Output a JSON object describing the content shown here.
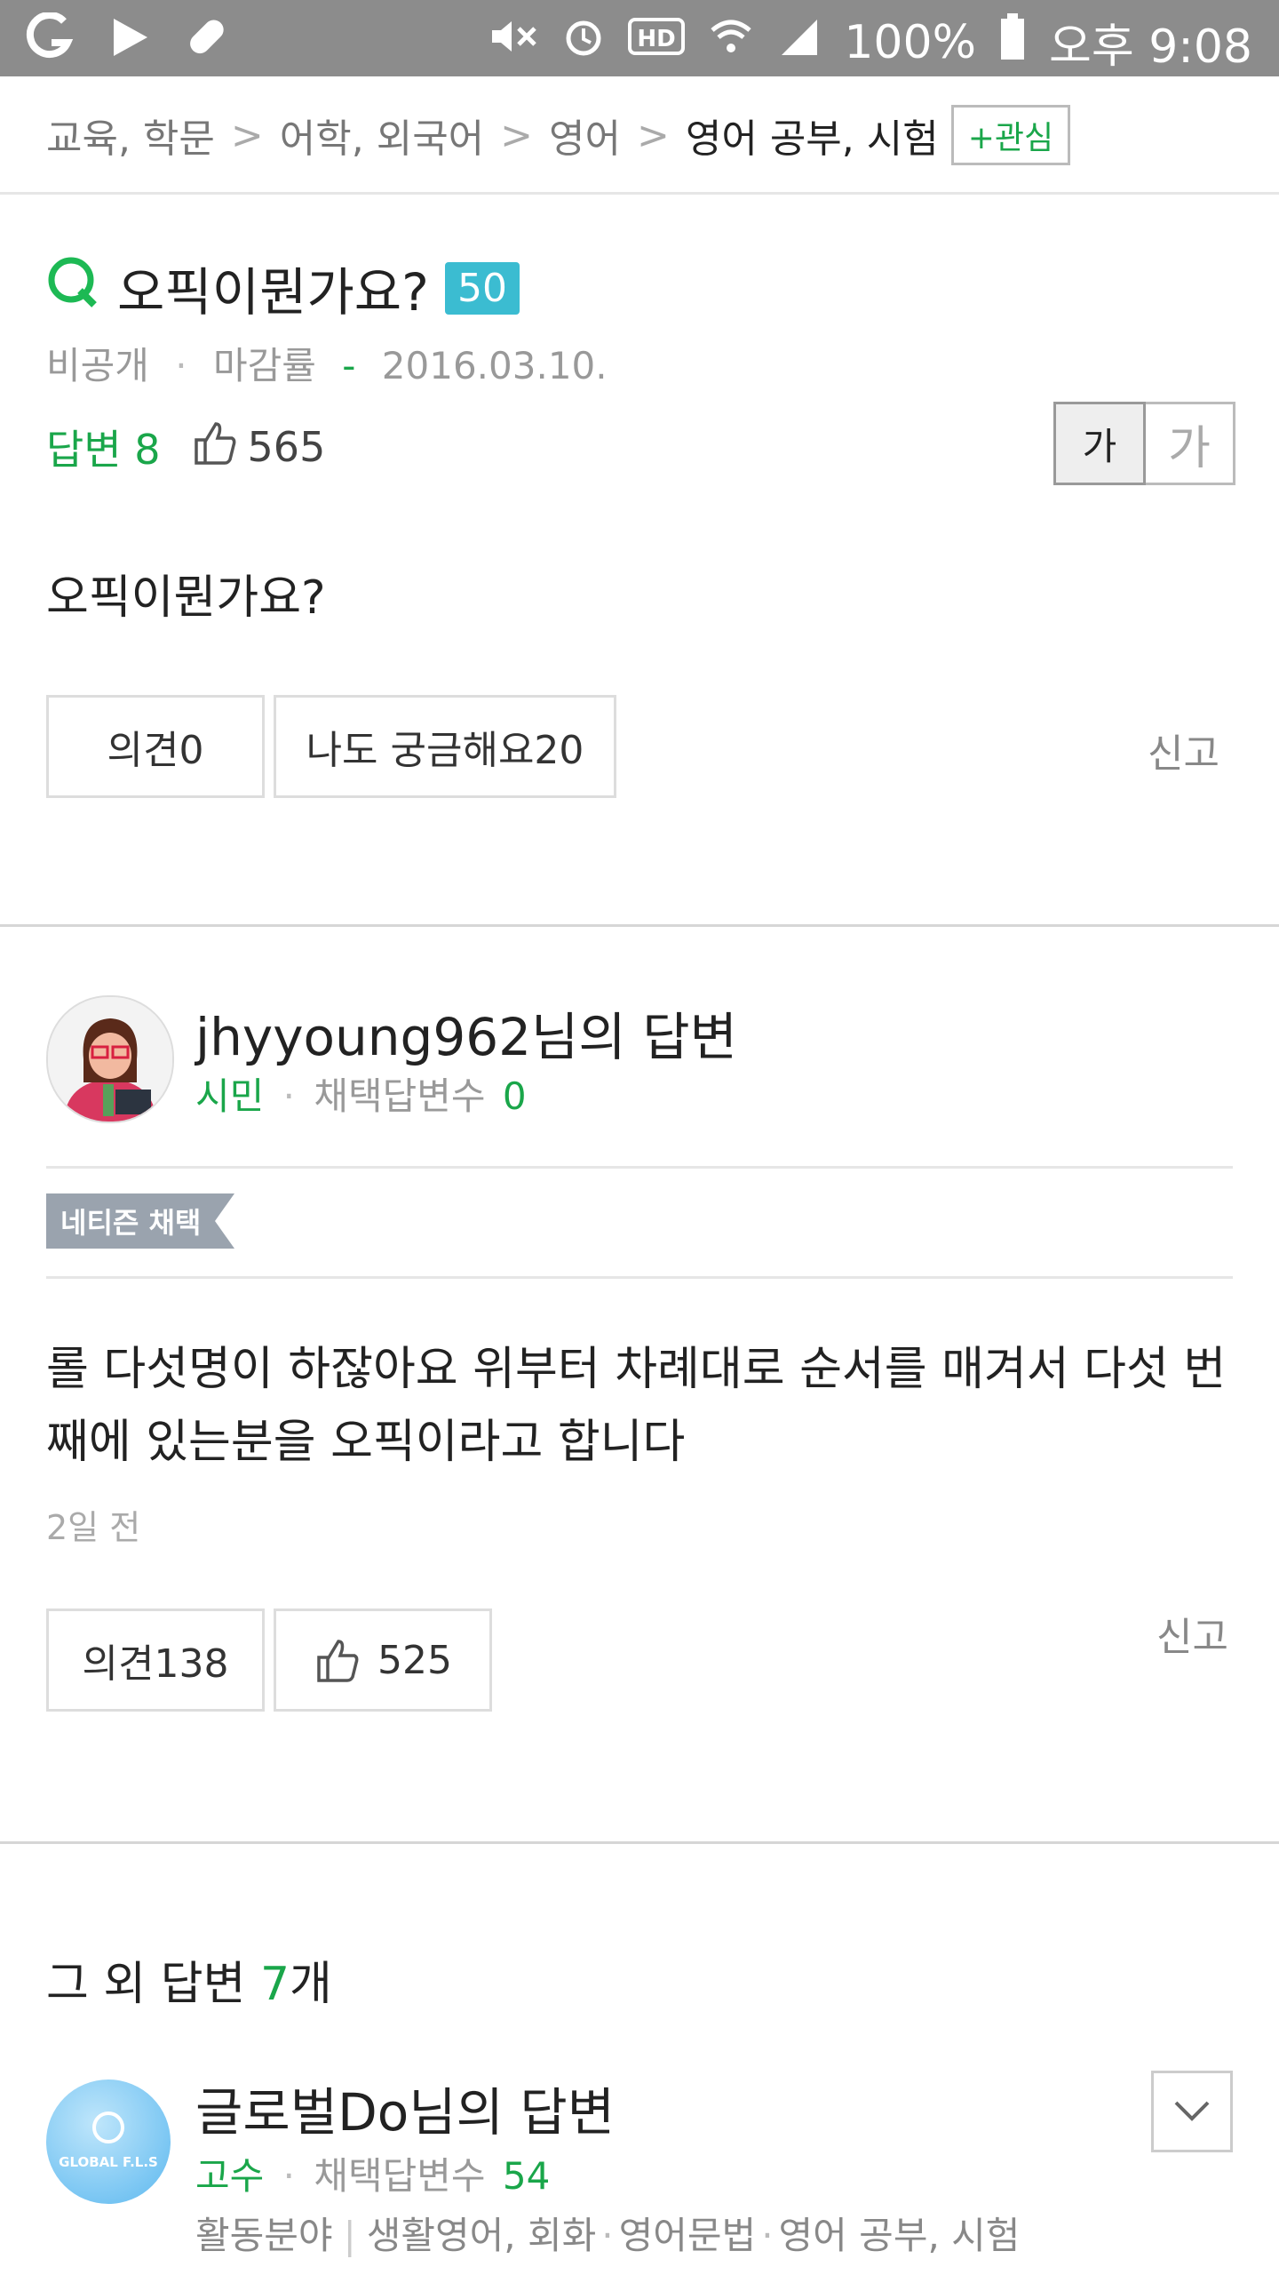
{
  "status_bar": {
    "battery": "100%",
    "time": "오후 9:08",
    "network": "HD"
  },
  "breadcrumb": {
    "items": [
      "교육, 학문",
      "어학, 외국어",
      "영어",
      "영어 공부, 시험"
    ],
    "separator": ">",
    "follow_label": "+관심"
  },
  "question": {
    "title": "오픽이뭔가요?",
    "points": "50",
    "visibility": "비공개",
    "deadline_label": "마감률",
    "deadline_value": "-",
    "date": "2016.03.10.",
    "answers_label": "답변 8",
    "likes": "565",
    "font_small": "가",
    "font_large": "가",
    "body": "오픽이뭔가요?",
    "opinion_button": "의견0",
    "curious_button": "나도 궁금해요20",
    "report": "신고"
  },
  "answer1": {
    "author": "jhyyoung962님의 답변",
    "rank": "시민",
    "adopted_label": "채택답변수",
    "adopted_count": "0",
    "badge": "네티즌 채택",
    "body": "롤 다섯명이 하잖아요 위부터 차례대로 순서를 매겨서 다섯 번째에 있는분을 오픽이라고 합니다",
    "time": "2일 전",
    "opinion_button": "의견138",
    "likes": "525",
    "report": "신고"
  },
  "others": {
    "title_prefix": "그 외 답변 ",
    "count": "7",
    "title_suffix": "개"
  },
  "answer2": {
    "author": "글로벌Do님의 답변",
    "rank": "고수",
    "adopted_label": "채택답변수",
    "adopted_count": "54",
    "fields_label": "활동분야",
    "fields": [
      "생활영어, 회화",
      "영어문법",
      "영어 공부, 시험"
    ],
    "avatar_text": "GLOBAL F.L.S"
  },
  "colors": {
    "accent_green": "#1aa64a",
    "points_badge": "#3bbcd1",
    "status_bar": "#8c8c8c",
    "badge_gray": "#9aa3ae"
  }
}
